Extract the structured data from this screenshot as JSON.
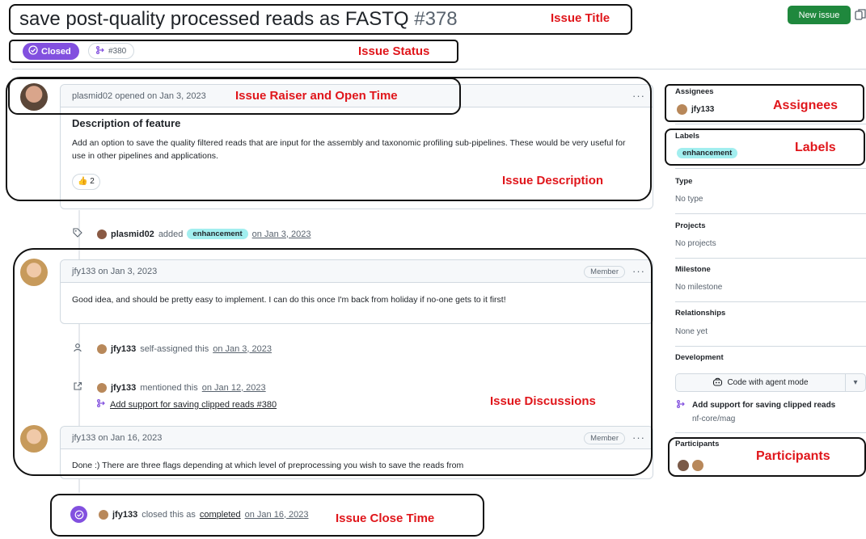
{
  "issue": {
    "title": "save post-quality processed reads as FASTQ",
    "number": "#378",
    "status": "Closed",
    "linked_pr": "#380"
  },
  "header": {
    "new_issue_label": "New issue"
  },
  "comments": [
    {
      "author": "plasmid02",
      "meta": "opened on Jan 3, 2023",
      "heading": "Description of feature",
      "body": "Add an option to save the quality filtered reads that are input for the assembly and taxonomic profiling sub-pipelines. These would be very useful for use in other pipelines and applications.",
      "reaction": "👍 2"
    },
    {
      "author": "jfy133",
      "meta": "on Jan 3, 2023",
      "role": "Member",
      "body": "Good idea, and should be pretty easy to implement. I can do this once I'm back from holiday if no-one gets to it first!"
    },
    {
      "author": "jfy133",
      "meta": "on Jan 16, 2023",
      "role": "Member",
      "body": "Done :) There are three flags depending at which level of preprocessing you wish to save the reads from"
    }
  ],
  "events": {
    "label_added": {
      "actor": "plasmid02",
      "action": "added",
      "label": "enhancement",
      "date": "on Jan 3, 2023"
    },
    "self_assigned": {
      "actor": "jfy133",
      "action": "self-assigned this",
      "date": "on Jan 3, 2023"
    },
    "mentioned": {
      "actor": "jfy133",
      "action": "mentioned this",
      "date": "on Jan 12, 2023",
      "pr_title": "Add support for saving clipped reads #380"
    },
    "closed": {
      "actor": "jfy133",
      "action_prefix": "closed this as",
      "completed": "completed",
      "date": "on Jan 16, 2023"
    }
  },
  "sidebar": {
    "assignees_title": "Assignees",
    "assignee": "jfy133",
    "labels_title": "Labels",
    "label": "enhancement",
    "type_title": "Type",
    "type_value": "No type",
    "projects_title": "Projects",
    "projects_value": "No projects",
    "milestone_title": "Milestone",
    "milestone_value": "No milestone",
    "relationships_title": "Relationships",
    "relationships_value": "None yet",
    "development_title": "Development",
    "agent_button": "Code with agent mode",
    "dev_pr_title": "Add support for saving clipped reads",
    "dev_pr_repo": "nf-core/mag",
    "participants_title": "Participants"
  },
  "annotations": {
    "issue_title": "Issue Title",
    "issue_status": "Issue Status",
    "raiser": "Issue Raiser and Open Time",
    "description": "Issue Description",
    "discussions": "Issue Discussions",
    "close_time": "Issue Close Time",
    "assignees": "Assignees",
    "labels": "Labels",
    "participants": "Participants"
  },
  "colors": {
    "closed_purple": "#8250df",
    "new_issue_green": "#1f883d",
    "label_enhancement": "#a2eeef",
    "annotation_red": "#e0161b"
  }
}
